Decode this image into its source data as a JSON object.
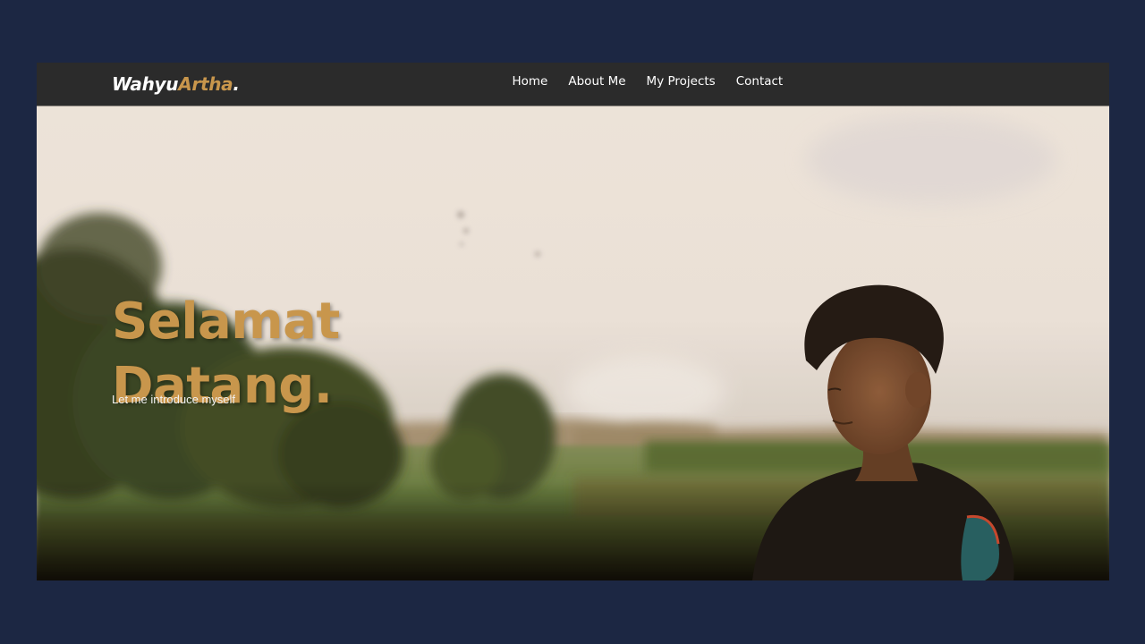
{
  "brand": {
    "name_primary": "Wahyu",
    "name_accent": "Artha",
    "name_suffix": "."
  },
  "nav": {
    "items": [
      {
        "label": "Home"
      },
      {
        "label": "About Me"
      },
      {
        "label": "My Projects"
      },
      {
        "label": "Contact"
      }
    ]
  },
  "hero": {
    "title_line1": "Selamat",
    "title_line2": "Datang.",
    "subtitle": "Let me introduce myself",
    "image": "portrait-photo-in-field"
  },
  "colors": {
    "page_background": "#1c2743",
    "navbar_background": "#2b2b2b",
    "accent": "#c8964c",
    "nav_text": "#ffffff"
  }
}
